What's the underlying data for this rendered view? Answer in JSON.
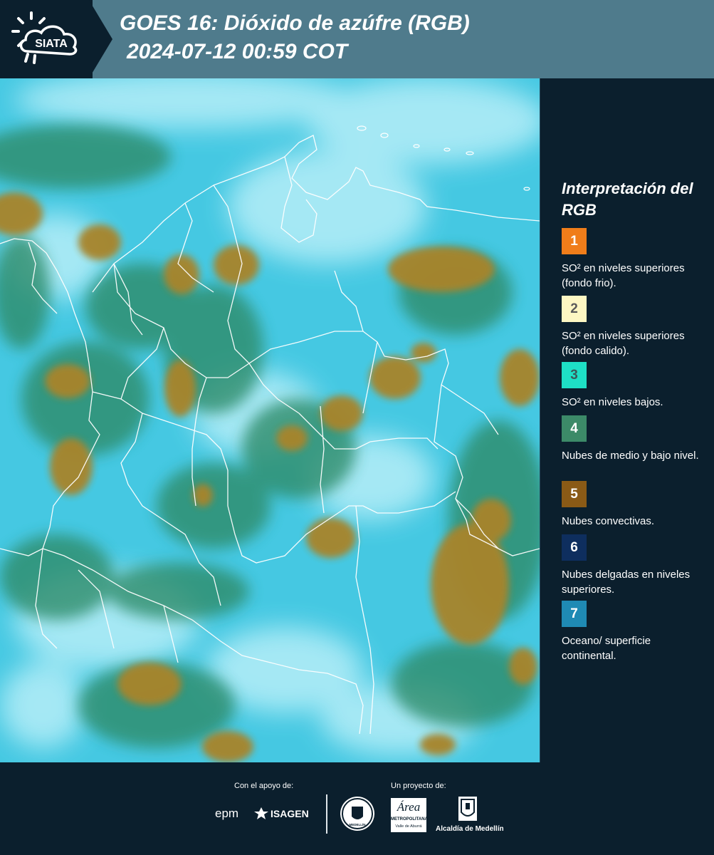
{
  "header": {
    "logo_text": "SIATA",
    "title_line1": "GOES 16: Dióxido de azúfre (RGB)",
    "title_line2": "2024-07-12 00:59 COT"
  },
  "legend": {
    "title": "Interpretación del RGB",
    "items": [
      {
        "number": "1",
        "color": "#f07d1a",
        "text_color": "#ffffff",
        "label": "SO² en niveles superiores (fondo frio)."
      },
      {
        "number": "2",
        "color": "#fdf7c3",
        "text_color": "#5a5a5a",
        "label": "SO² en niveles superiores (fondo calido)."
      },
      {
        "number": "3",
        "color": "#1ee0c6",
        "text_color": "#3a5a5a",
        "label": "SO² en niveles bajos."
      },
      {
        "number": "4",
        "color": "#3c8a68",
        "text_color": "#ffffff",
        "label": "Nubes de medio y bajo nivel."
      },
      {
        "number": "5",
        "color": "#8a5a16",
        "text_color": "#ffffff",
        "label": "Nubes convectivas."
      },
      {
        "number": "6",
        "color": "#0e2e5e",
        "text_color": "#ffffff",
        "label": "Nubes delgadas en niveles superiores."
      },
      {
        "number": "7",
        "color": "#1f8ab4",
        "text_color": "#ffffff",
        "label": "Oceano/ superficie continental."
      }
    ]
  },
  "footer": {
    "support_label": "Con el apoyo de:",
    "project_label": "Un proyecto de:",
    "sponsor_epm": "epm",
    "sponsor_isagen": "ISAGEN",
    "seal_text": "MEDELLÍN",
    "area_name": "Área",
    "area_sub1": "METROPOLITANA",
    "area_sub2": "Valle de Aburrá",
    "alcaldia": "Alcaldía de Medellín"
  }
}
